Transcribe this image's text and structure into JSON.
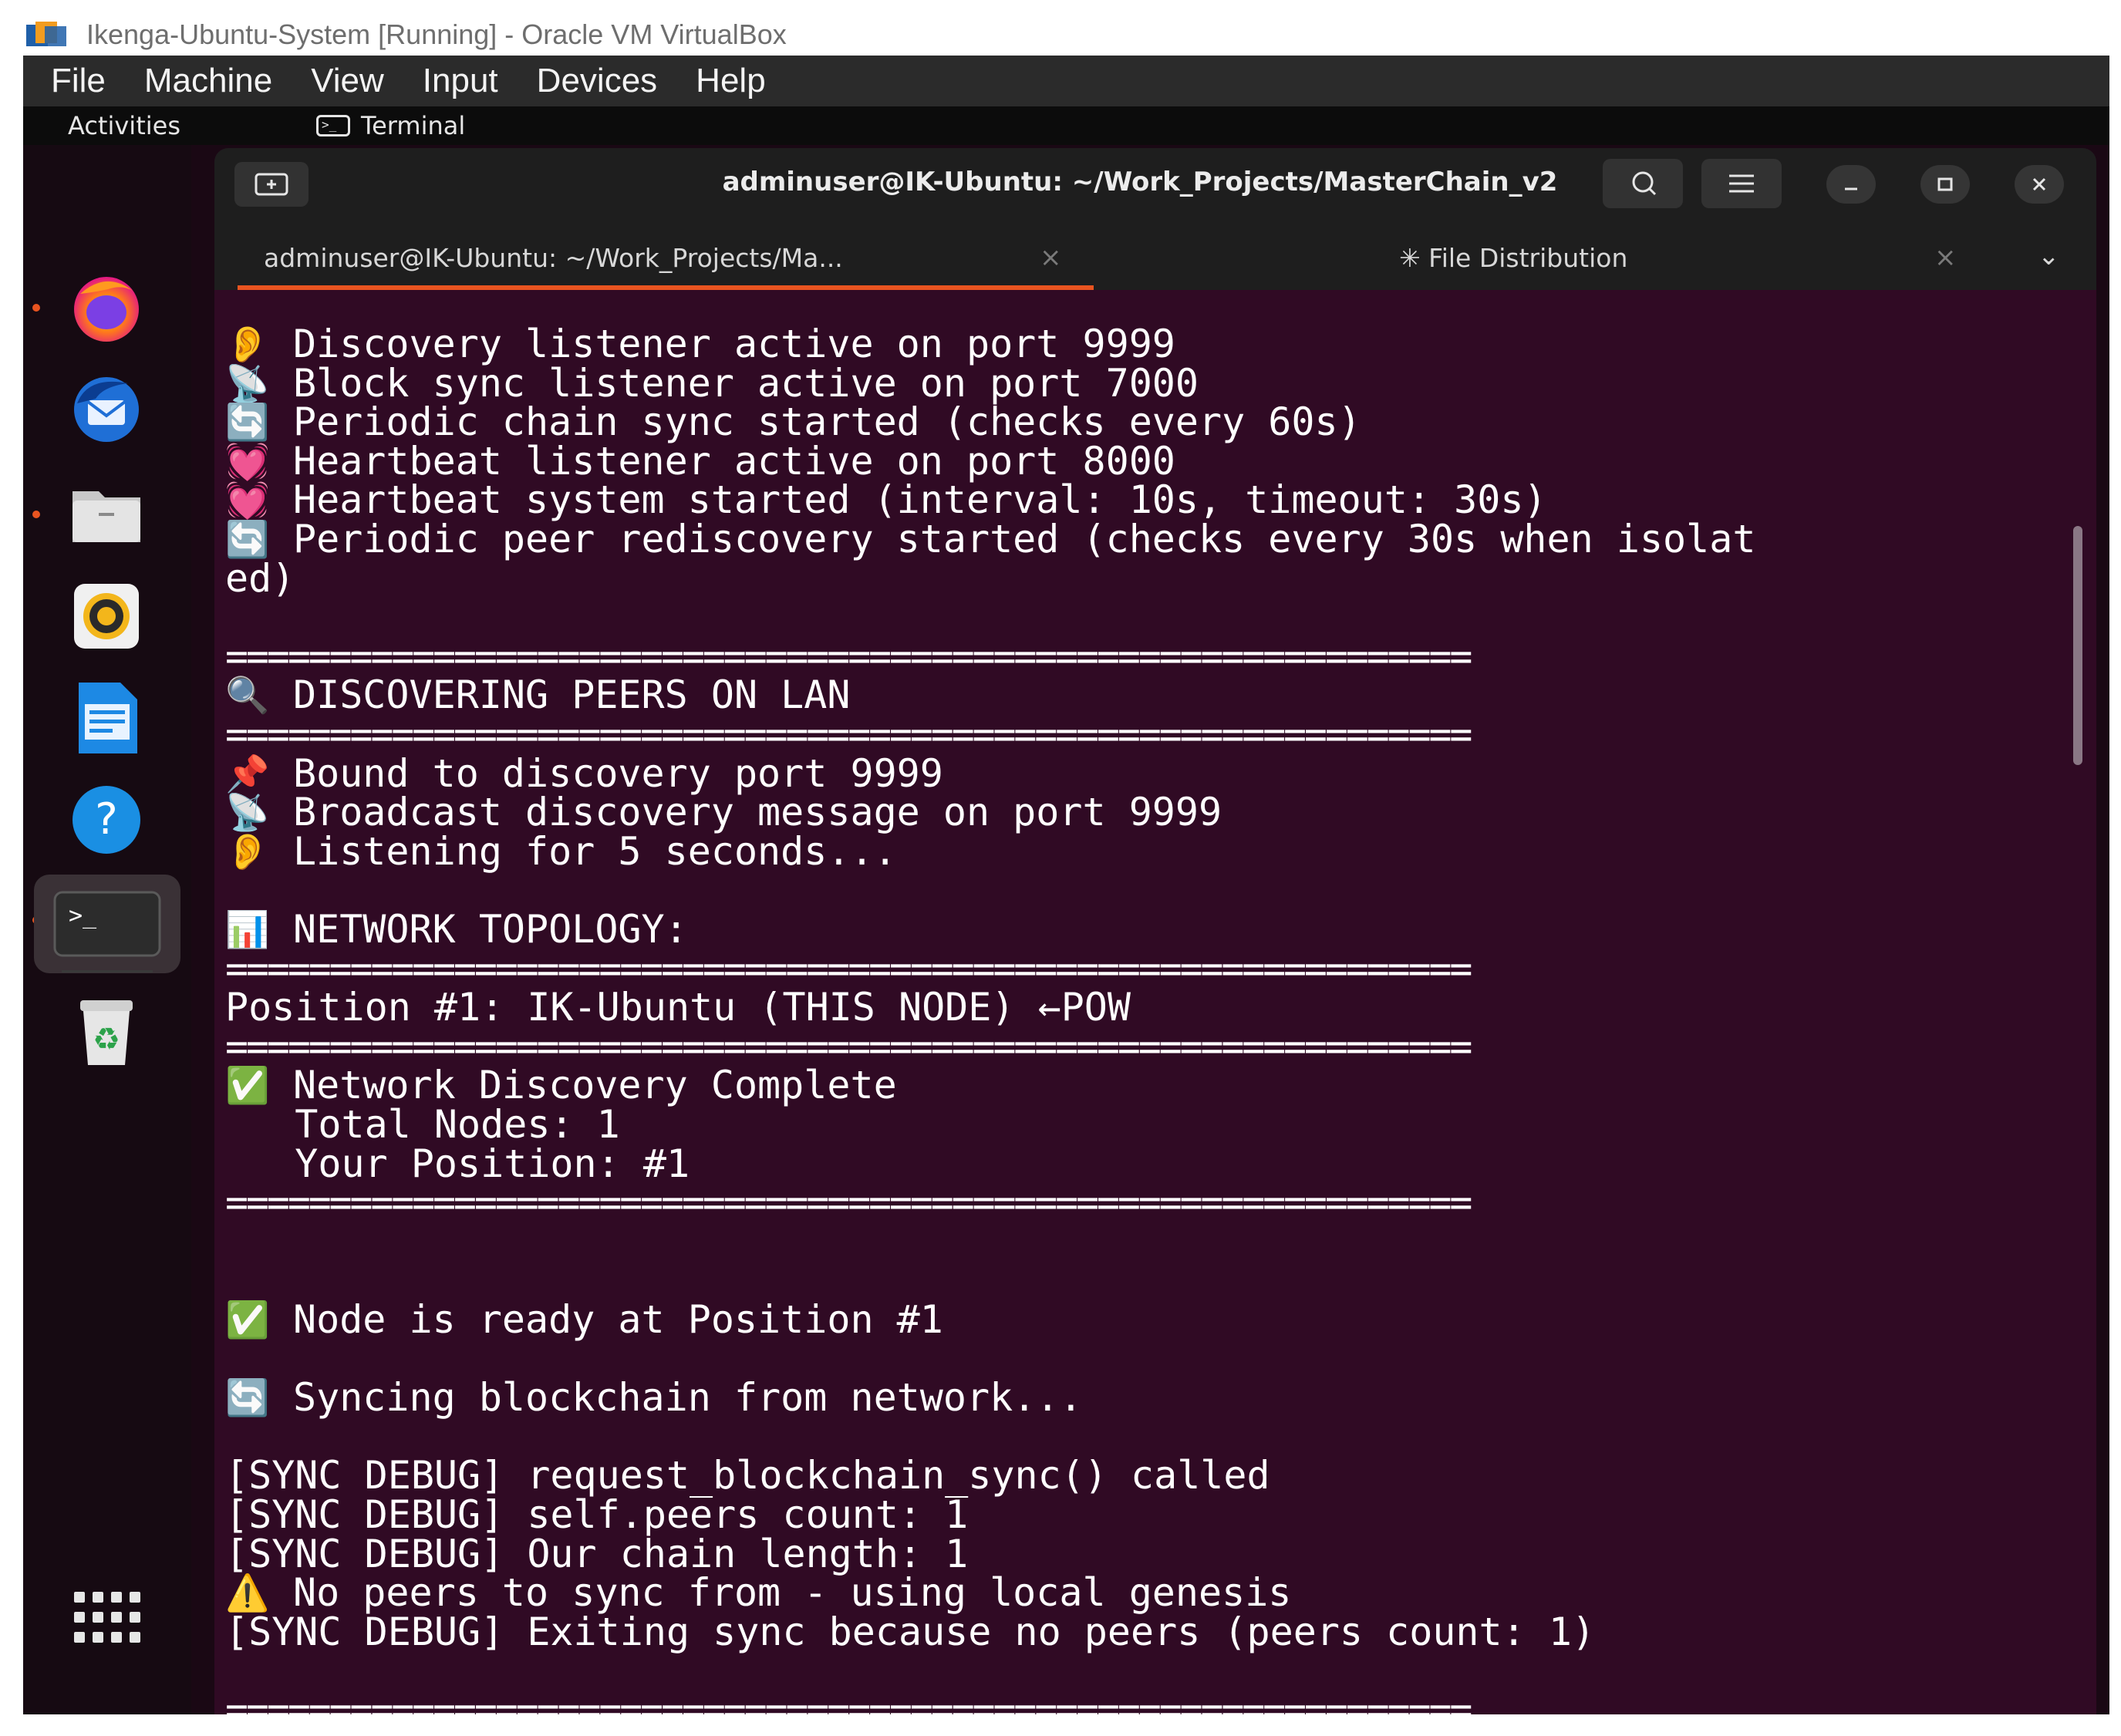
{
  "host_window": {
    "title": "Ikenga-Ubuntu-System [Running] - Oracle VM VirtualBox",
    "menu": [
      "File",
      "Machine",
      "View",
      "Input",
      "Devices",
      "Help"
    ]
  },
  "guest_topbar": {
    "activities": "Activities",
    "app_name": "Terminal",
    "app_icon": ">_"
  },
  "dock": {
    "items": [
      {
        "name": "firefox",
        "running": true
      },
      {
        "name": "thunderbird",
        "running": false
      },
      {
        "name": "files",
        "running": true
      },
      {
        "name": "rhythmbox",
        "running": false
      },
      {
        "name": "libreoffice-writer",
        "running": false
      },
      {
        "name": "help",
        "running": false,
        "glyph": "?"
      },
      {
        "name": "terminal",
        "running": true,
        "glyph": ">_"
      },
      {
        "name": "trash",
        "running": false,
        "glyph": "♻"
      }
    ],
    "apps_grid_icon": "show-apps-icon"
  },
  "terminal": {
    "title": "adminuser@IK-Ubuntu: ~/Work_Projects/MasterChain_v2",
    "tabs": [
      {
        "label": "adminuser@IK-Ubuntu: ~/Work_Projects/Ma...",
        "active": true
      },
      {
        "label": "✳ File Distribution",
        "active": false
      }
    ],
    "close_glyph": "×",
    "menu_glyph": "⌄",
    "colors": {
      "background": "#300a24",
      "accent": "#e95420",
      "text": "#ffffff"
    },
    "lines": [
      {
        "icon": "👂",
        "text": "Discovery listener active on port 9999"
      },
      {
        "icon": "📡",
        "text": "Block sync listener active on port 7000"
      },
      {
        "icon": "🔄",
        "text": "Periodic chain sync started (checks every 60s)"
      },
      {
        "icon": "💓",
        "text": "Heartbeat listener active on port 8000"
      },
      {
        "icon": "💓",
        "text": "Heartbeat system started (interval: 10s, timeout: 30s)"
      },
      {
        "icon": "🔄",
        "text": "Periodic peer rediscovery started (checks every 30s when isolat"
      },
      {
        "icon": "",
        "text": "ed)"
      },
      {
        "icon": "",
        "text": ""
      },
      {
        "icon": "",
        "text": "============================================================"
      },
      {
        "icon": "🔍",
        "text": "DISCOVERING PEERS ON LAN"
      },
      {
        "icon": "",
        "text": "============================================================"
      },
      {
        "icon": "📌",
        "text": "Bound to discovery port 9999"
      },
      {
        "icon": "📡",
        "text": "Broadcast discovery message on port 9999"
      },
      {
        "icon": "👂",
        "text": "Listening for 5 seconds..."
      },
      {
        "icon": "",
        "text": ""
      },
      {
        "icon": "📊",
        "text": "NETWORK TOPOLOGY:"
      },
      {
        "icon": "",
        "text": "============================================================"
      },
      {
        "icon": "",
        "text": "Position #1: IK-Ubuntu (THIS NODE) ←POW"
      },
      {
        "icon": "",
        "text": "============================================================"
      },
      {
        "icon": "✅",
        "text": "Network Discovery Complete"
      },
      {
        "icon": "",
        "text": "   Total Nodes: 1"
      },
      {
        "icon": "",
        "text": "   Your Position: #1"
      },
      {
        "icon": "",
        "text": "============================================================"
      },
      {
        "icon": "",
        "text": ""
      },
      {
        "icon": "",
        "text": ""
      },
      {
        "icon": "✅",
        "text": "Node is ready at Position #1"
      },
      {
        "icon": "",
        "text": ""
      },
      {
        "icon": "🔄",
        "text": "Syncing blockchain from network..."
      },
      {
        "icon": "",
        "text": ""
      },
      {
        "icon": "",
        "text": "[SYNC DEBUG] request_blockchain_sync() called"
      },
      {
        "icon": "",
        "text": "[SYNC DEBUG] self.peers count: 1"
      },
      {
        "icon": "",
        "text": "[SYNC DEBUG] Our chain length: 1"
      },
      {
        "icon": "⚠️",
        "text": "No peers to sync from - using local genesis"
      },
      {
        "icon": "",
        "text": "[SYNC DEBUG] Exiting sync because no peers (peers count: 1)"
      },
      {
        "icon": "",
        "text": ""
      },
      {
        "icon": "",
        "text": "============================================================"
      }
    ]
  }
}
